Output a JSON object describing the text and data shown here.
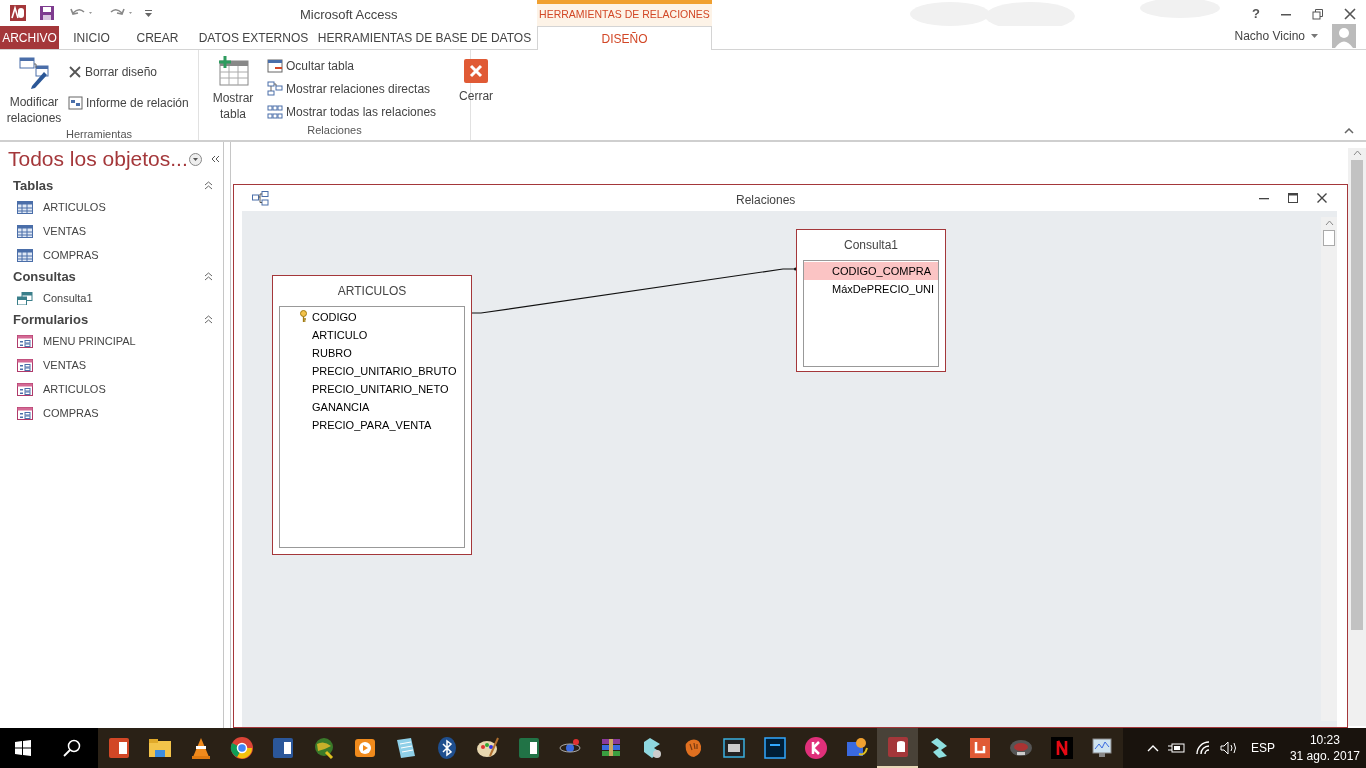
{
  "window": {
    "title": "Microsoft Access",
    "help": "?"
  },
  "contextual_tab_group": {
    "label": "HERRAMIENTAS DE RELACIONES"
  },
  "tabs": [
    {
      "label": "ARCHIVO",
      "kind": "file",
      "selected": false
    },
    {
      "label": "INICIO",
      "kind": "tab",
      "selected": false
    },
    {
      "label": "CREAR",
      "kind": "tab",
      "selected": false
    },
    {
      "label": "DATOS EXTERNOS",
      "kind": "tab",
      "selected": false
    },
    {
      "label": "HERRAMIENTAS DE BASE DE DATOS",
      "kind": "tab",
      "selected": false
    },
    {
      "label": "DISEÑO",
      "kind": "contextual",
      "selected": true
    }
  ],
  "user": {
    "name": "Nacho Vicino"
  },
  "ribbon_groups": [
    {
      "label": "Herramientas",
      "buttons": [
        {
          "label": "Modificar relaciones",
          "kind": "large"
        },
        {
          "label": "Borrar diseño",
          "kind": "small"
        },
        {
          "label": "Informe de relación",
          "kind": "small"
        }
      ]
    },
    {
      "label": "Relaciones",
      "buttons": [
        {
          "label": "Mostrar tabla",
          "kind": "large"
        },
        {
          "label": "Ocultar tabla",
          "kind": "small"
        },
        {
          "label": "Mostrar relaciones directas",
          "kind": "small"
        },
        {
          "label": "Mostrar todas las relaciones",
          "kind": "small"
        },
        {
          "label": "Cerrar",
          "kind": "large"
        }
      ]
    }
  ],
  "navigation_pane": {
    "title": "Todos los objetos...",
    "groups": [
      {
        "label": "Tablas",
        "expanded": true,
        "items": [
          {
            "label": "ARTICULOS",
            "kind": "table"
          },
          {
            "label": "VENTAS",
            "kind": "table"
          },
          {
            "label": "COMPRAS",
            "kind": "table"
          }
        ]
      },
      {
        "label": "Consultas",
        "expanded": true,
        "items": [
          {
            "label": "Consulta1",
            "kind": "query"
          }
        ]
      },
      {
        "label": "Formularios",
        "expanded": true,
        "items": [
          {
            "label": "MENU PRINCIPAL",
            "kind": "form"
          },
          {
            "label": "VENTAS",
            "kind": "form"
          },
          {
            "label": "ARTICULOS",
            "kind": "form"
          },
          {
            "label": "COMPRAS",
            "kind": "form"
          }
        ]
      }
    ]
  },
  "relationships_window": {
    "title": "Relaciones",
    "tables": [
      {
        "name": "ARTICULOS",
        "fields": [
          {
            "name": "CODIGO",
            "primary_key": true,
            "selected": false
          },
          {
            "name": "ARTICULO",
            "primary_key": false,
            "selected": false
          },
          {
            "name": "RUBRO",
            "primary_key": false,
            "selected": false
          },
          {
            "name": "PRECIO_UNITARIO_BRUTO",
            "primary_key": false,
            "selected": false
          },
          {
            "name": "PRECIO_UNITARIO_NETO",
            "primary_key": false,
            "selected": false
          },
          {
            "name": "GANANCIA",
            "primary_key": false,
            "selected": false
          },
          {
            "name": "PRECIO_PARA_VENTA",
            "primary_key": false,
            "selected": false
          }
        ]
      },
      {
        "name": "Consulta1",
        "fields": [
          {
            "name": "CODIGO_COMPRA",
            "primary_key": false,
            "selected": true
          },
          {
            "name": "MáxDePRECIO_UNI",
            "primary_key": false,
            "selected": false
          }
        ]
      }
    ]
  },
  "taskbar": {
    "language": "ESP",
    "time": "10:23",
    "date": "31 ago. 2017"
  }
}
